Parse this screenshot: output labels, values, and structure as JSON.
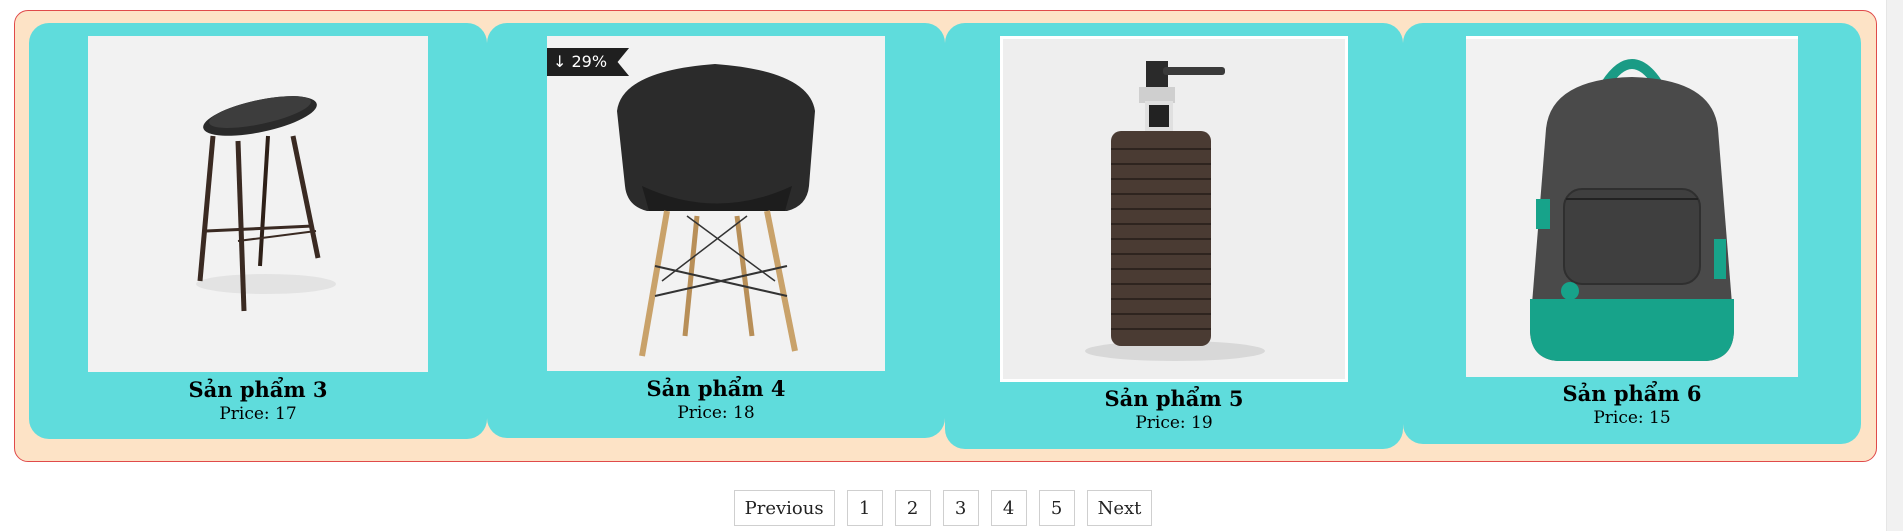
{
  "products": [
    {
      "name": "Sản phẩm 3",
      "price_label": "Price: 17"
    },
    {
      "name": "Sản phẩm 4",
      "price_label": "Price: 18",
      "badge": "↓ 29%"
    },
    {
      "name": "Sản phẩm 5",
      "price_label": "Price: 19"
    },
    {
      "name": "Sản phẩm 6",
      "price_label": "Price: 15"
    }
  ],
  "pagination": {
    "previous": "Previous",
    "pages": [
      "1",
      "2",
      "3",
      "4",
      "5"
    ],
    "next": "Next"
  },
  "colors": {
    "panel_background": "#fde3c6",
    "panel_border": "#e04a4a",
    "card_background": "#5fdcdc"
  }
}
